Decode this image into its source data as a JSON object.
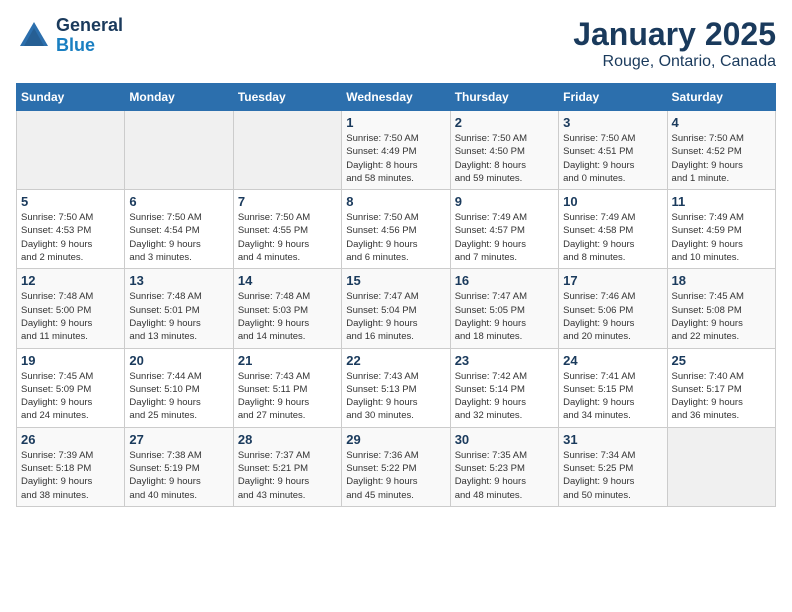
{
  "header": {
    "logo_line1": "General",
    "logo_line2": "Blue",
    "month": "January 2025",
    "location": "Rouge, Ontario, Canada"
  },
  "days_of_week": [
    "Sunday",
    "Monday",
    "Tuesday",
    "Wednesday",
    "Thursday",
    "Friday",
    "Saturday"
  ],
  "weeks": [
    [
      {
        "day": "",
        "info": ""
      },
      {
        "day": "",
        "info": ""
      },
      {
        "day": "",
        "info": ""
      },
      {
        "day": "1",
        "info": "Sunrise: 7:50 AM\nSunset: 4:49 PM\nDaylight: 8 hours\nand 58 minutes."
      },
      {
        "day": "2",
        "info": "Sunrise: 7:50 AM\nSunset: 4:50 PM\nDaylight: 8 hours\nand 59 minutes."
      },
      {
        "day": "3",
        "info": "Sunrise: 7:50 AM\nSunset: 4:51 PM\nDaylight: 9 hours\nand 0 minutes."
      },
      {
        "day": "4",
        "info": "Sunrise: 7:50 AM\nSunset: 4:52 PM\nDaylight: 9 hours\nand 1 minute."
      }
    ],
    [
      {
        "day": "5",
        "info": "Sunrise: 7:50 AM\nSunset: 4:53 PM\nDaylight: 9 hours\nand 2 minutes."
      },
      {
        "day": "6",
        "info": "Sunrise: 7:50 AM\nSunset: 4:54 PM\nDaylight: 9 hours\nand 3 minutes."
      },
      {
        "day": "7",
        "info": "Sunrise: 7:50 AM\nSunset: 4:55 PM\nDaylight: 9 hours\nand 4 minutes."
      },
      {
        "day": "8",
        "info": "Sunrise: 7:50 AM\nSunset: 4:56 PM\nDaylight: 9 hours\nand 6 minutes."
      },
      {
        "day": "9",
        "info": "Sunrise: 7:49 AM\nSunset: 4:57 PM\nDaylight: 9 hours\nand 7 minutes."
      },
      {
        "day": "10",
        "info": "Sunrise: 7:49 AM\nSunset: 4:58 PM\nDaylight: 9 hours\nand 8 minutes."
      },
      {
        "day": "11",
        "info": "Sunrise: 7:49 AM\nSunset: 4:59 PM\nDaylight: 9 hours\nand 10 minutes."
      }
    ],
    [
      {
        "day": "12",
        "info": "Sunrise: 7:48 AM\nSunset: 5:00 PM\nDaylight: 9 hours\nand 11 minutes."
      },
      {
        "day": "13",
        "info": "Sunrise: 7:48 AM\nSunset: 5:01 PM\nDaylight: 9 hours\nand 13 minutes."
      },
      {
        "day": "14",
        "info": "Sunrise: 7:48 AM\nSunset: 5:03 PM\nDaylight: 9 hours\nand 14 minutes."
      },
      {
        "day": "15",
        "info": "Sunrise: 7:47 AM\nSunset: 5:04 PM\nDaylight: 9 hours\nand 16 minutes."
      },
      {
        "day": "16",
        "info": "Sunrise: 7:47 AM\nSunset: 5:05 PM\nDaylight: 9 hours\nand 18 minutes."
      },
      {
        "day": "17",
        "info": "Sunrise: 7:46 AM\nSunset: 5:06 PM\nDaylight: 9 hours\nand 20 minutes."
      },
      {
        "day": "18",
        "info": "Sunrise: 7:45 AM\nSunset: 5:08 PM\nDaylight: 9 hours\nand 22 minutes."
      }
    ],
    [
      {
        "day": "19",
        "info": "Sunrise: 7:45 AM\nSunset: 5:09 PM\nDaylight: 9 hours\nand 24 minutes."
      },
      {
        "day": "20",
        "info": "Sunrise: 7:44 AM\nSunset: 5:10 PM\nDaylight: 9 hours\nand 25 minutes."
      },
      {
        "day": "21",
        "info": "Sunrise: 7:43 AM\nSunset: 5:11 PM\nDaylight: 9 hours\nand 27 minutes."
      },
      {
        "day": "22",
        "info": "Sunrise: 7:43 AM\nSunset: 5:13 PM\nDaylight: 9 hours\nand 30 minutes."
      },
      {
        "day": "23",
        "info": "Sunrise: 7:42 AM\nSunset: 5:14 PM\nDaylight: 9 hours\nand 32 minutes."
      },
      {
        "day": "24",
        "info": "Sunrise: 7:41 AM\nSunset: 5:15 PM\nDaylight: 9 hours\nand 34 minutes."
      },
      {
        "day": "25",
        "info": "Sunrise: 7:40 AM\nSunset: 5:17 PM\nDaylight: 9 hours\nand 36 minutes."
      }
    ],
    [
      {
        "day": "26",
        "info": "Sunrise: 7:39 AM\nSunset: 5:18 PM\nDaylight: 9 hours\nand 38 minutes."
      },
      {
        "day": "27",
        "info": "Sunrise: 7:38 AM\nSunset: 5:19 PM\nDaylight: 9 hours\nand 40 minutes."
      },
      {
        "day": "28",
        "info": "Sunrise: 7:37 AM\nSunset: 5:21 PM\nDaylight: 9 hours\nand 43 minutes."
      },
      {
        "day": "29",
        "info": "Sunrise: 7:36 AM\nSunset: 5:22 PM\nDaylight: 9 hours\nand 45 minutes."
      },
      {
        "day": "30",
        "info": "Sunrise: 7:35 AM\nSunset: 5:23 PM\nDaylight: 9 hours\nand 48 minutes."
      },
      {
        "day": "31",
        "info": "Sunrise: 7:34 AM\nSunset: 5:25 PM\nDaylight: 9 hours\nand 50 minutes."
      },
      {
        "day": "",
        "info": ""
      }
    ]
  ]
}
